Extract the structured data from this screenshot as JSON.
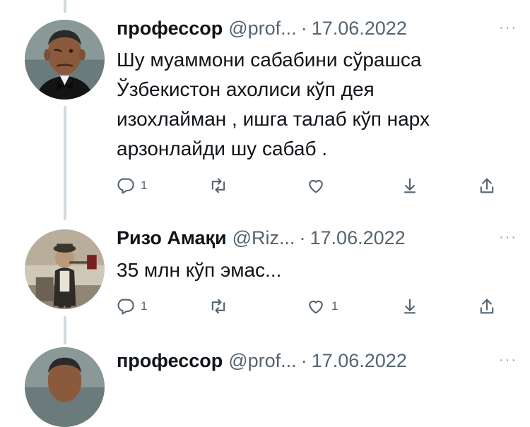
{
  "tweets": [
    {
      "author": "профессор",
      "handle": "@prof...",
      "separator": "·",
      "date": "17.06.2022",
      "more": "···",
      "text": "Шу муаммони сабабини сўрашса\nЎзбекистон ахолиси кўп дея\nизохлайман , ишга талаб кўп нарх\nарзонлайди шу сабаб .",
      "actions": {
        "reply_count": "1",
        "retweet_count": "",
        "like_count": ""
      },
      "avatar": "obama-portrait"
    },
    {
      "author": "Ризо Амақи",
      "handle": "@Riz...",
      "separator": "·",
      "date": "17.06.2022",
      "more": "···",
      "text": "35 млн кўп эмас...",
      "actions": {
        "reply_count": "1",
        "retweet_count": "",
        "like_count": "1"
      },
      "avatar": "sepia-man-photo"
    },
    {
      "author": "профессор",
      "handle": "@prof...",
      "separator": "·",
      "date": "17.06.2022",
      "more": "···",
      "avatar": "obama-portrait"
    }
  ],
  "colors": {
    "text": "#0f1419",
    "secondary": "#536471",
    "thread_line": "#cfd9de",
    "background": "#ffffff"
  },
  "icons": [
    "reply-icon",
    "retweet-icon",
    "like-icon",
    "bookmark-icon",
    "share-icon",
    "more-icon"
  ]
}
